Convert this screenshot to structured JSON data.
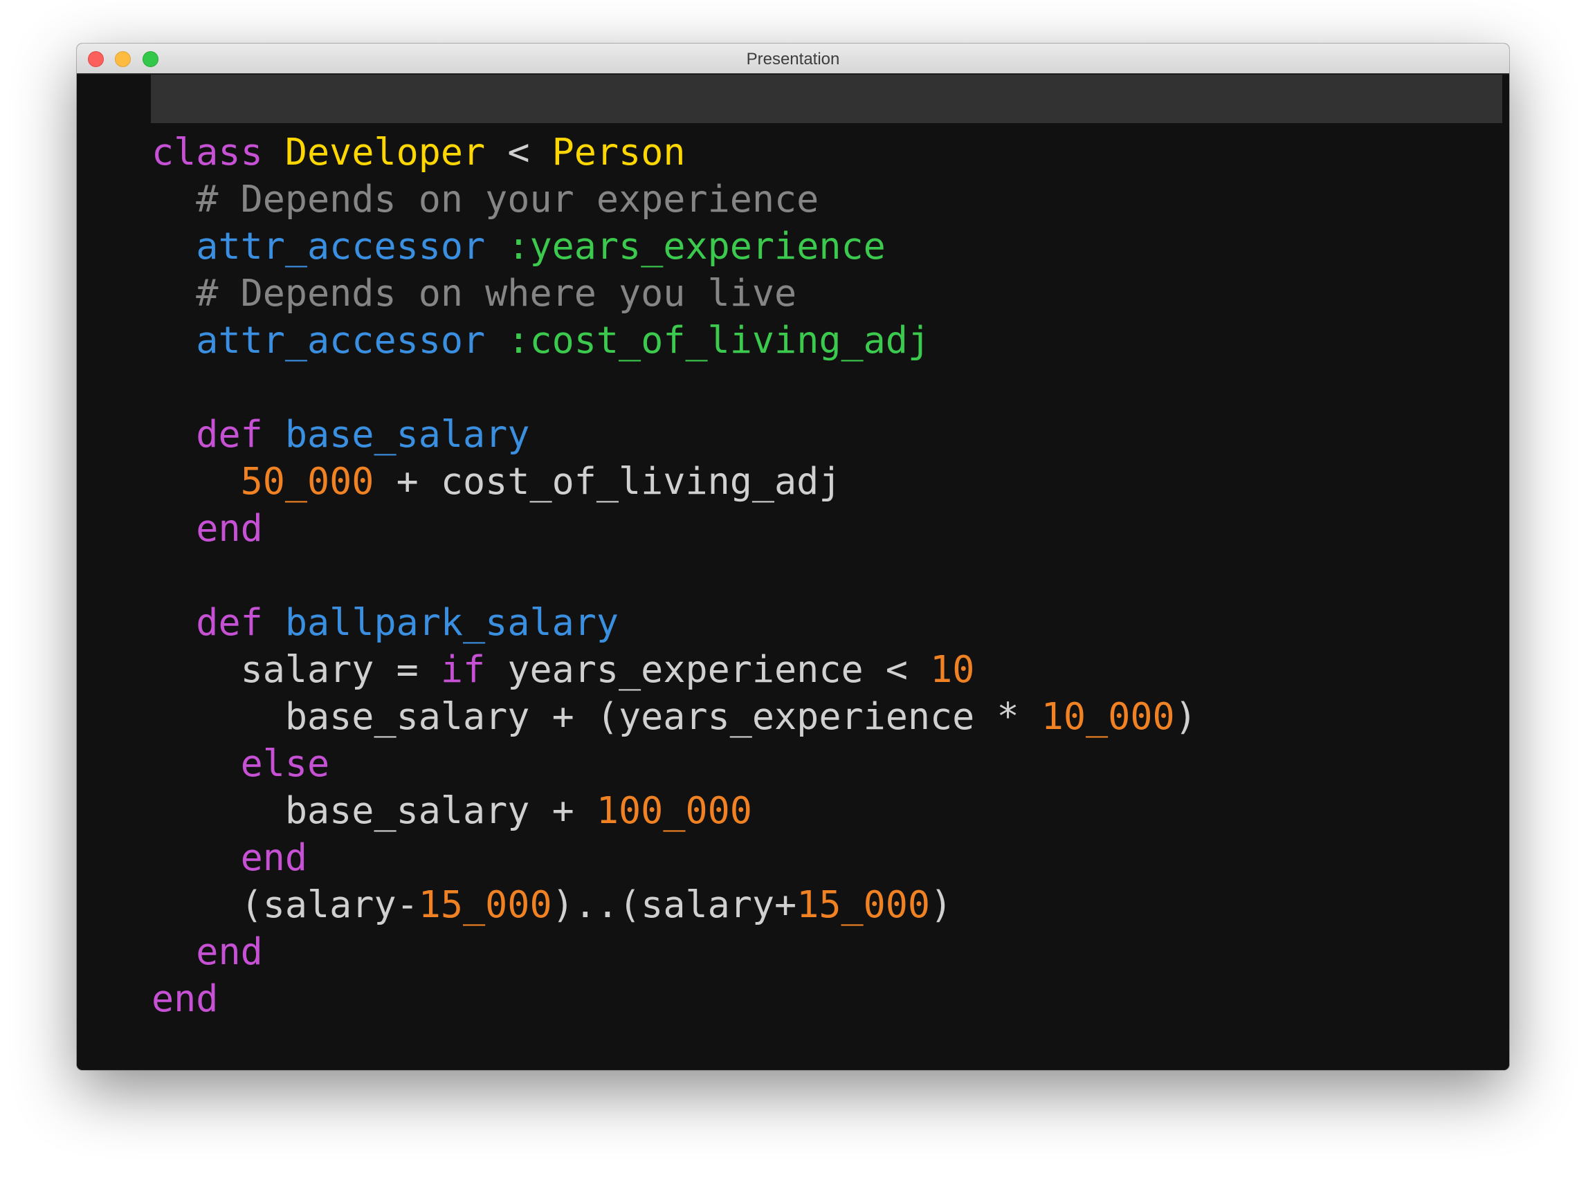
{
  "window": {
    "title": "Presentation"
  },
  "colors": {
    "keyword": "#c651d4",
    "constant": "#ffd700",
    "plain": "#d0d0d0",
    "comment": "#858585",
    "method": "#3a8fe0",
    "symbol": "#3bc94e",
    "number": "#f08224",
    "background": "#111111",
    "current_line": "#323232"
  },
  "code": {
    "lines": [
      [
        {
          "t": "class",
          "c": "keyword"
        },
        {
          "t": " ",
          "c": "plain"
        },
        {
          "t": "Developer",
          "c": "const"
        },
        {
          "t": " < ",
          "c": "plain"
        },
        {
          "t": "Person",
          "c": "const"
        }
      ],
      [
        {
          "t": "  # Depends on your experience",
          "c": "comment"
        }
      ],
      [
        {
          "t": "  ",
          "c": "plain"
        },
        {
          "t": "attr_accessor",
          "c": "method"
        },
        {
          "t": " ",
          "c": "plain"
        },
        {
          "t": ":years_experience",
          "c": "symbol"
        }
      ],
      [
        {
          "t": "  # Depends on where you live",
          "c": "comment"
        }
      ],
      [
        {
          "t": "  ",
          "c": "plain"
        },
        {
          "t": "attr_accessor",
          "c": "method"
        },
        {
          "t": " ",
          "c": "plain"
        },
        {
          "t": ":cost_of_living_adj",
          "c": "symbol"
        }
      ],
      [],
      [
        {
          "t": "  ",
          "c": "plain"
        },
        {
          "t": "def",
          "c": "keyword"
        },
        {
          "t": " ",
          "c": "plain"
        },
        {
          "t": "base_salary",
          "c": "method"
        }
      ],
      [
        {
          "t": "    ",
          "c": "plain"
        },
        {
          "t": "50_000",
          "c": "number"
        },
        {
          "t": " + cost_of_living_adj",
          "c": "plain"
        }
      ],
      [
        {
          "t": "  ",
          "c": "plain"
        },
        {
          "t": "end",
          "c": "keyword"
        }
      ],
      [],
      [
        {
          "t": "  ",
          "c": "plain"
        },
        {
          "t": "def",
          "c": "keyword"
        },
        {
          "t": " ",
          "c": "plain"
        },
        {
          "t": "ballpark_salary",
          "c": "method"
        }
      ],
      [
        {
          "t": "    salary = ",
          "c": "plain"
        },
        {
          "t": "if",
          "c": "keyword"
        },
        {
          "t": " years_experience < ",
          "c": "plain"
        },
        {
          "t": "10",
          "c": "number"
        }
      ],
      [
        {
          "t": "      base_salary + (years_experience * ",
          "c": "plain"
        },
        {
          "t": "10_000",
          "c": "number"
        },
        {
          "t": ")",
          "c": "plain"
        }
      ],
      [
        {
          "t": "    ",
          "c": "plain"
        },
        {
          "t": "else",
          "c": "keyword"
        }
      ],
      [
        {
          "t": "      base_salary + ",
          "c": "plain"
        },
        {
          "t": "100_000",
          "c": "number"
        }
      ],
      [
        {
          "t": "    ",
          "c": "plain"
        },
        {
          "t": "end",
          "c": "keyword"
        }
      ],
      [
        {
          "t": "    (salary-",
          "c": "plain"
        },
        {
          "t": "15_000",
          "c": "number"
        },
        {
          "t": ")..(salary+",
          "c": "plain"
        },
        {
          "t": "15_000",
          "c": "number"
        },
        {
          "t": ")",
          "c": "plain"
        }
      ],
      [
        {
          "t": "  ",
          "c": "plain"
        },
        {
          "t": "end",
          "c": "keyword"
        }
      ],
      [
        {
          "t": "end",
          "c": "keyword"
        }
      ]
    ]
  }
}
